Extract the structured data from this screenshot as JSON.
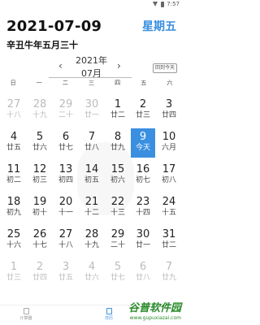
{
  "status_bar": {
    "time": "7:57"
  },
  "header": {
    "date": "2021-07-09",
    "weekday": "星期五",
    "lunar": "辛丑牛年五月三十",
    "colors": {
      "accent": "#3a8fe0"
    }
  },
  "nav": {
    "year": "2021年",
    "month": "07月",
    "prev_icon": "chevron-left-icon",
    "next_icon": "chevron-right-icon",
    "today_button": "回到今天"
  },
  "week_days": [
    "日",
    "一",
    "二",
    "三",
    "四",
    "五",
    "六"
  ],
  "weeks": [
    [
      {
        "d": "27",
        "l": "十八",
        "o": true
      },
      {
        "d": "28",
        "l": "十九",
        "o": true
      },
      {
        "d": "29",
        "l": "二十",
        "o": true
      },
      {
        "d": "30",
        "l": "廿一",
        "o": true
      },
      {
        "d": "1",
        "l": "廿二"
      },
      {
        "d": "2",
        "l": "廿三"
      },
      {
        "d": "3",
        "l": "廿四"
      }
    ],
    [
      {
        "d": "4",
        "l": "廿五"
      },
      {
        "d": "5",
        "l": "廿六"
      },
      {
        "d": "6",
        "l": "廿七"
      },
      {
        "d": "7",
        "l": "廿八"
      },
      {
        "d": "8",
        "l": "廿九"
      },
      {
        "d": "9",
        "l": "今天",
        "today": true
      },
      {
        "d": "10",
        "l": "六月"
      }
    ],
    [
      {
        "d": "11",
        "l": "初二"
      },
      {
        "d": "12",
        "l": "初三"
      },
      {
        "d": "13",
        "l": "初四"
      },
      {
        "d": "14",
        "l": "初五"
      },
      {
        "d": "15",
        "l": "初六"
      },
      {
        "d": "16",
        "l": "初七"
      },
      {
        "d": "17",
        "l": "初八"
      }
    ],
    [
      {
        "d": "18",
        "l": "初九"
      },
      {
        "d": "19",
        "l": "初十"
      },
      {
        "d": "20",
        "l": "十一"
      },
      {
        "d": "21",
        "l": "十二"
      },
      {
        "d": "22",
        "l": "十三"
      },
      {
        "d": "23",
        "l": "十四"
      },
      {
        "d": "24",
        "l": "十五"
      }
    ],
    [
      {
        "d": "25",
        "l": "十六"
      },
      {
        "d": "26",
        "l": "十七"
      },
      {
        "d": "27",
        "l": "十八"
      },
      {
        "d": "28",
        "l": "十九"
      },
      {
        "d": "29",
        "l": "二十"
      },
      {
        "d": "30",
        "l": "廿一"
      },
      {
        "d": "31",
        "l": "廿二"
      }
    ],
    [
      {
        "d": "1",
        "l": "廿三",
        "o": true
      },
      {
        "d": "2",
        "l": "廿四",
        "o": true
      },
      {
        "d": "3",
        "l": "廿五",
        "o": true
      },
      {
        "d": "4",
        "l": "廿六",
        "o": true
      },
      {
        "d": "5",
        "l": "廿七",
        "o": true
      },
      {
        "d": "6",
        "l": "廿八",
        "o": true
      },
      {
        "d": "7",
        "l": "廿九",
        "o": true
      }
    ]
  ],
  "bottom_nav": {
    "tabs": [
      {
        "label": "计算器",
        "icon": "calculator-icon"
      },
      {
        "label": "日历",
        "icon": "calendar-icon"
      }
    ]
  },
  "brand": {
    "name": "谷普软件园",
    "url": "www.gupuxiazai.com"
  }
}
